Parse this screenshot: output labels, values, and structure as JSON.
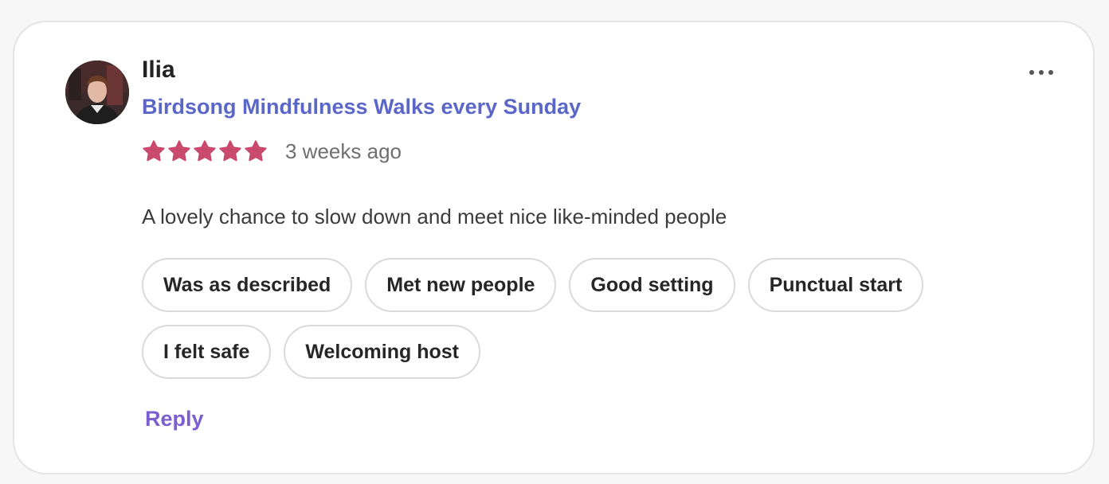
{
  "review": {
    "author_name": "Ilia",
    "event_title": "Birdsong Mindfulness Walks every Sunday",
    "rating": 5,
    "rating_max": 5,
    "time_ago": "3 weeks ago",
    "text": "A lovely chance to slow down and meet nice like-minded people",
    "tags": [
      {
        "label": "Was as described"
      },
      {
        "label": "Met new people"
      },
      {
        "label": "Good setting"
      },
      {
        "label": "Punctual start"
      },
      {
        "label": "I felt safe"
      },
      {
        "label": "Welcoming host"
      }
    ],
    "reply_label": "Reply",
    "icons": {
      "avatar": "user-avatar",
      "star": "star-icon",
      "more": "more-horizontal-icon"
    }
  },
  "colors": {
    "star": "#c94a6b",
    "event_link": "#5a67c9",
    "reply": "#7b5fcf",
    "text_primary": "#222222",
    "text_secondary": "#6f6f6f",
    "card_border": "#e4e4e7",
    "tag_border": "#dadadd"
  }
}
